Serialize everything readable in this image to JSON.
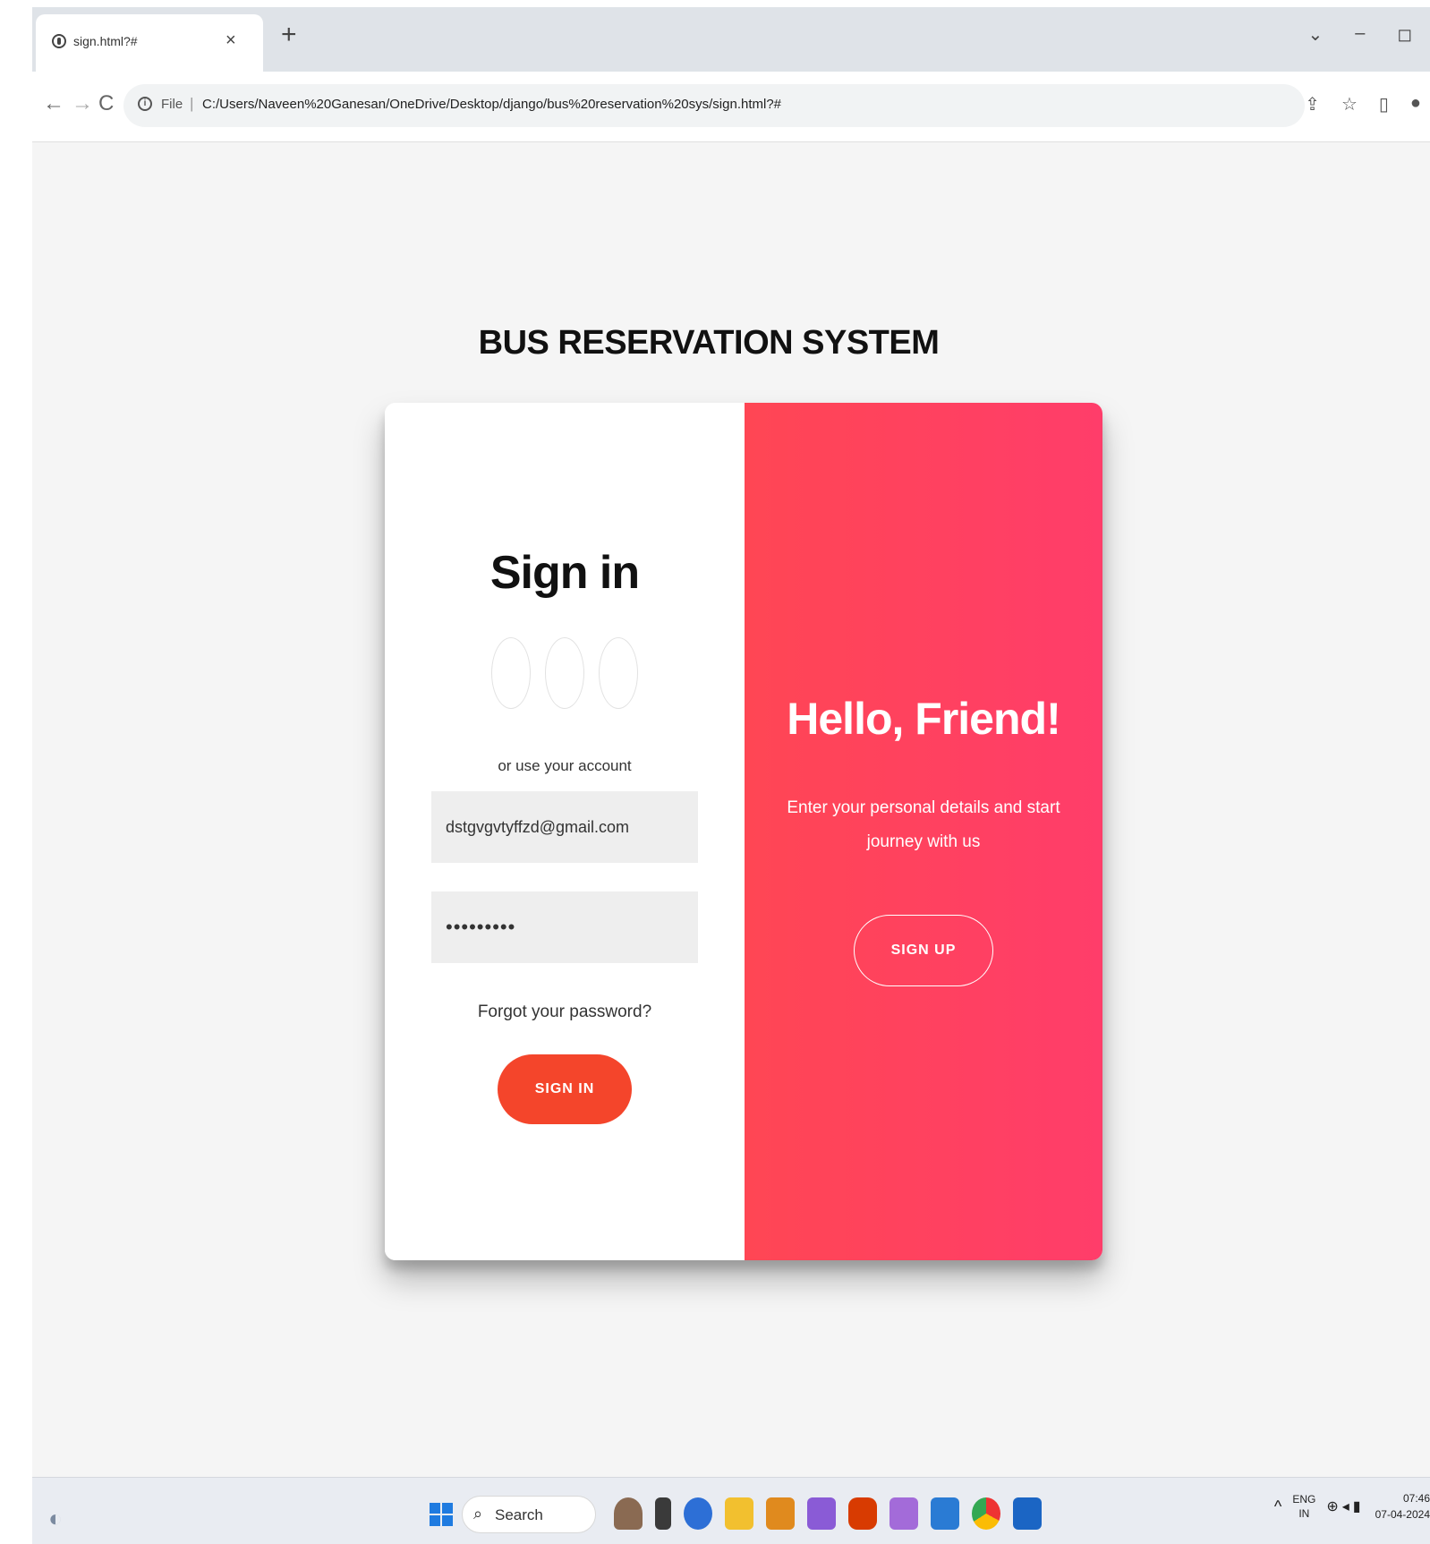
{
  "browser": {
    "tab_title": "sign.html?#",
    "tab_close": "×",
    "new_tab": "+",
    "window_controls": {
      "chevron": "⌄",
      "minimize": "–",
      "restore": "◻"
    },
    "nav": {
      "back": "←",
      "forward": "→",
      "reload": "C"
    },
    "omnibox": {
      "scheme": "File",
      "separator": "|",
      "url": "C:/Users/Naveen%20Ganesan/OneDrive/Desktop/django/bus%20reservation%20sys/sign.html?#"
    },
    "toolbar_icons": [
      "share-icon",
      "star-icon",
      "sidebar-icon",
      "profile-icon"
    ]
  },
  "page": {
    "heading": "BUS RESERVATION SYSTEM",
    "signin": {
      "title": "Sign in",
      "social_icons": [
        "social-icon-1",
        "social-icon-2",
        "social-icon-3"
      ],
      "subtitle": "or use your account",
      "email_value": "dstgvgvtyffzd@gmail.com",
      "password_value": "•••••••••",
      "forgot_link": "Forgot your password?",
      "button_label": "SIGN IN"
    },
    "overlay": {
      "title": "Hello, Friend!",
      "text": "Enter your personal details and start journey with us",
      "button_label": "SIGN UP"
    }
  },
  "taskbar": {
    "search_label": "Search",
    "apps": [
      "animal-app-icon",
      "file-explorer-icon",
      "dev-app-icon",
      "folder-icon",
      "sublime-icon",
      "visual-studio-icon",
      "office-icon",
      "visual-studio-2-icon",
      "vscode-icon",
      "chrome-icon",
      "photos-icon"
    ],
    "tray": {
      "chevron": "^",
      "lang_1": "ENG",
      "lang_2": "IN",
      "time": "07:46",
      "date": "07-04-2024"
    }
  },
  "colors": {
    "signin_button": "#f4452b",
    "overlay_gradient_start": "#ff4654",
    "overlay_gradient_end": "#ff3d6a",
    "page_background": "#f5f5f5"
  }
}
